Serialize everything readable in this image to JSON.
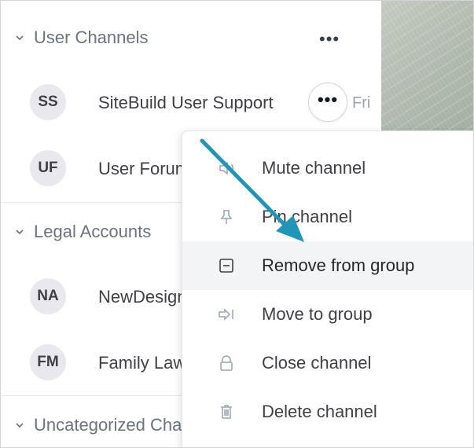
{
  "groups": [
    {
      "label": "User Channels"
    },
    {
      "label": "Legal Accounts"
    },
    {
      "label": "Uncategorized Channels"
    }
  ],
  "channels": [
    {
      "initials": "SS",
      "name": "SiteBuild User Support",
      "time": "Fri"
    },
    {
      "initials": "UF",
      "name": "User Forum"
    },
    {
      "initials": "NA",
      "name": "NewDesign Account"
    },
    {
      "initials": "FM",
      "name": "Family Law"
    }
  ],
  "group_more_label": "•••",
  "row_more_label": "•••",
  "menu": {
    "items": [
      {
        "label": "Mute channel",
        "icon": "speaker-mute-icon"
      },
      {
        "label": "Pin channel",
        "icon": "pin-icon"
      },
      {
        "label": "Remove from group",
        "icon": "minus-square-icon",
        "active": true
      },
      {
        "label": "Move to group",
        "icon": "move-arrow-icon"
      },
      {
        "label": "Close channel",
        "icon": "lock-icon"
      },
      {
        "label": "Delete channel",
        "icon": "trash-icon"
      }
    ]
  },
  "colors": {
    "annotation_arrow": "#1f95b8",
    "avatar_bg": "#e8e8ee",
    "active_item_bg": "#f3f4f6"
  }
}
